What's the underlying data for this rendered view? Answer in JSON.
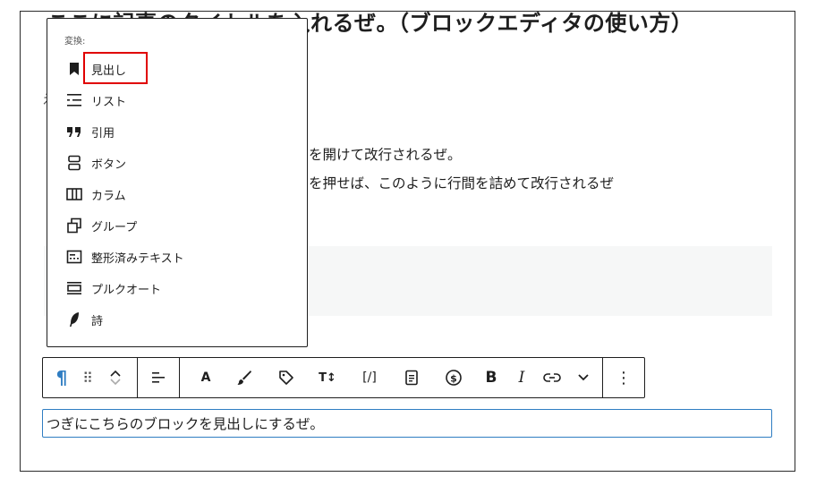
{
  "editor": {
    "title_text": "ここに記事のタイトルを入れるぜ。（ブロックエディタの使い方）",
    "stray_char": "え",
    "paragraph_1": "を開けて改行されるぜ。",
    "paragraph_2": "を押せば、このように行間を詰めて改行されるぜ",
    "selected_block_text": "つぎにこちらのブロックを見出しにするぜ。"
  },
  "transform_menu": {
    "heading": "変換:",
    "items": [
      {
        "label": "見出し",
        "icon": "bookmark-icon"
      },
      {
        "label": "リスト",
        "icon": "list-icon"
      },
      {
        "label": "引用",
        "icon": "quote-icon"
      },
      {
        "label": "ボタン",
        "icon": "button-icon"
      },
      {
        "label": "カラム",
        "icon": "columns-icon"
      },
      {
        "label": "グループ",
        "icon": "group-icon"
      },
      {
        "label": "整形済みテキスト",
        "icon": "preformatted-icon"
      },
      {
        "label": "プルクオート",
        "icon": "pullquote-icon"
      },
      {
        "label": "詩",
        "icon": "quill-icon"
      }
    ],
    "highlight_color": "#e00000"
  },
  "toolbar": {
    "paragraph_glyph": "¶",
    "drag_glyph": "⠿",
    "bold_label": "B",
    "italic_label": "I",
    "text_color_label": "A",
    "font_size_label": "T↕",
    "code_label": "[/]",
    "more_glyph": "⋮",
    "accent_color": "#2f7dc2"
  }
}
